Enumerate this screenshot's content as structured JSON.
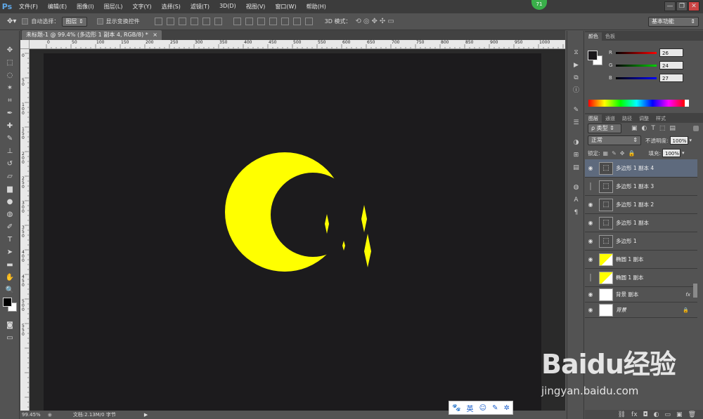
{
  "app": {
    "logo": "Ps",
    "notification_count": "71"
  },
  "menu": [
    "文件(F)",
    "编辑(E)",
    "图像(I)",
    "图层(L)",
    "文字(Y)",
    "选择(S)",
    "滤镜(T)",
    "3D(D)",
    "视图(V)",
    "窗口(W)",
    "帮助(H)"
  ],
  "window_controls": {
    "minimize": "—",
    "restore": "❐",
    "close": "✕"
  },
  "options": {
    "auto_select_label": "自动选择：",
    "auto_select_value": "图层",
    "show_transform_label": "显示变换控件",
    "mode_3d_label": "3D 模式：",
    "workspace": "基本功能"
  },
  "document": {
    "tab_title": "未标题-1 @ 99.4% (多边形 1 副本 4, RGB/8) *",
    "tab_close": "×",
    "ruler_h": [
      "0",
      "50",
      "100",
      "150",
      "200",
      "250",
      "300",
      "350",
      "400",
      "450",
      "500",
      "550",
      "600",
      "650",
      "700",
      "750",
      "800",
      "850",
      "900",
      "950",
      "1000"
    ],
    "ruler_v": [
      "0",
      "5\n0",
      "1\n0\n0",
      "1\n5\n0",
      "2\n0\n0",
      "2\n5\n0",
      "3\n0\n0",
      "3\n5\n0",
      "4\n0\n0",
      "4\n5\n0",
      "5\n0\n0",
      "5\n5\n0"
    ],
    "background_color": "#1c1b1d",
    "shape_color": "#ffff00"
  },
  "status": {
    "zoom": "99.45%",
    "doc_info": "文档:2.13M/0 字节"
  },
  "color_panel": {
    "tabs": [
      "颜色",
      "色板"
    ],
    "channels": [
      {
        "label": "R",
        "value": "26",
        "gradient": "#ff0000"
      },
      {
        "label": "G",
        "value": "24",
        "gradient": "#00d000"
      },
      {
        "label": "B",
        "value": "27",
        "gradient": "#0000ff"
      }
    ]
  },
  "layers_panel": {
    "tabs": [
      "图层",
      "通道",
      "路径",
      "调整",
      "样式"
    ],
    "filter_label": "ρ 类型",
    "blend_mode": "正常",
    "opacity_label": "不透明度:",
    "opacity_value": "100%",
    "lock_label": "锁定:",
    "fill_label": "填充:",
    "fill_value": "100%",
    "layers": [
      {
        "name": "多边形 1 副本 4",
        "kind": "shape",
        "visible": true,
        "selected": true
      },
      {
        "name": "多边形 1 副本 3",
        "kind": "shape",
        "visible": false,
        "selected": false
      },
      {
        "name": "多边形 1 副本 2",
        "kind": "shape",
        "visible": true,
        "selected": false
      },
      {
        "name": "多边形 1 副本",
        "kind": "shape",
        "visible": true,
        "selected": false
      },
      {
        "name": "多边形 1",
        "kind": "shape",
        "visible": true,
        "selected": false
      },
      {
        "name": "椭圆 1 副本",
        "kind": "ellipse",
        "visible": true,
        "selected": false
      },
      {
        "name": "椭圆 1 副本",
        "kind": "ellipse",
        "visible": false,
        "selected": false
      },
      {
        "name": "背景 副本",
        "kind": "fill",
        "visible": true,
        "selected": false,
        "badge": "fx"
      },
      {
        "name": "背景",
        "kind": "fill",
        "visible": true,
        "selected": false,
        "badge": "🔒"
      }
    ],
    "bottom_buttons": [
      "⛓",
      "fx",
      "◘",
      "◐",
      "▭",
      "▣",
      "🗑"
    ]
  },
  "watermark": {
    "brand": "Baidu经验",
    "url": "jingyan.baidu.com"
  },
  "ime_toolbar": [
    "🐾",
    "英",
    "☺",
    "✎",
    "✲"
  ]
}
